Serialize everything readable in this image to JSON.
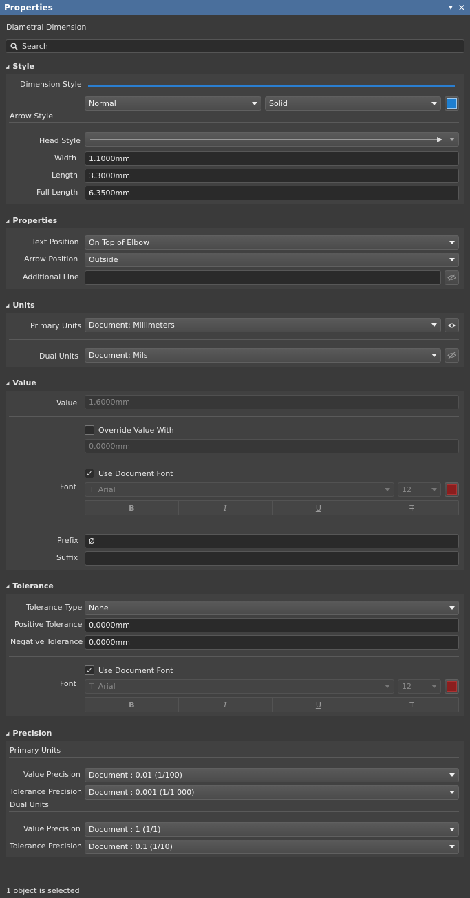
{
  "window": {
    "title": "Properties",
    "pin_icon": "pin-icon",
    "close_icon": "close-icon"
  },
  "object_type": "Diametral Dimension",
  "search": {
    "placeholder": "Search",
    "icon": "search-icon"
  },
  "style": {
    "header": "Style",
    "dimension_style_label": "Dimension Style",
    "line_width_value": "Normal",
    "line_style_value": "Solid",
    "color": "#1e7fd0",
    "arrow_style_label": "Arrow Style",
    "head_style_label": "Head Style",
    "width_label": "Width",
    "width_value": "1.1000mm",
    "length_label": "Length",
    "length_value": "3.3000mm",
    "full_length_label": "Full Length",
    "full_length_value": "6.3500mm"
  },
  "properties": {
    "header": "Properties",
    "text_position_label": "Text Position",
    "text_position_value": "On Top of Elbow",
    "arrow_position_label": "Arrow Position",
    "arrow_position_value": "Outside",
    "additional_line_label": "Additional Line",
    "additional_line_value": ""
  },
  "units": {
    "header": "Units",
    "primary_label": "Primary Units",
    "primary_value": "Document: Millimeters",
    "dual_label": "Dual Units",
    "dual_value": "Document: Mils"
  },
  "value": {
    "header": "Value",
    "value_label": "Value",
    "value_value": "1.6000mm",
    "override_label": "Override Value With",
    "override_checked": false,
    "override_value": "0.0000mm",
    "font_label": "Font",
    "use_doc_font_label": "Use Document Font",
    "use_doc_font_checked": true,
    "font_name": "Arial",
    "font_size": "12",
    "font_color": "#8b1e1e",
    "fmt_bold": "B",
    "fmt_italic": "I",
    "fmt_underline": "U",
    "fmt_strike": "T",
    "prefix_label": "Prefix",
    "prefix_value": "Ø",
    "suffix_label": "Suffix",
    "suffix_value": ""
  },
  "tolerance": {
    "header": "Tolerance",
    "type_label": "Tolerance Type",
    "type_value": "None",
    "positive_label": "Positive Tolerance",
    "positive_value": "0.0000mm",
    "negative_label": "Negative Tolerance",
    "negative_value": "0.0000mm",
    "font_label": "Font",
    "use_doc_font_label": "Use Document Font",
    "use_doc_font_checked": true,
    "font_name": "Arial",
    "font_size": "12",
    "font_color": "#8b1e1e",
    "fmt_bold": "B",
    "fmt_italic": "I",
    "fmt_underline": "U",
    "fmt_strike": "T"
  },
  "precision": {
    "header": "Precision",
    "primary_units_label": "Primary Units",
    "p_value_precision_label": "Value Precision",
    "p_value_precision_value": "Document : 0.01 (1/100)",
    "p_tolerance_precision_label": "Tolerance Precision",
    "p_tolerance_precision_value": "Document : 0.001 (1/1 000)",
    "dual_units_label": "Dual Units",
    "d_value_precision_label": "Value Precision",
    "d_value_precision_value": "Document : 1 (1/1)",
    "d_tolerance_precision_label": "Tolerance Precision",
    "d_tolerance_precision_value": "Document : 0.1 (1/10)"
  },
  "status": "1 object is selected"
}
